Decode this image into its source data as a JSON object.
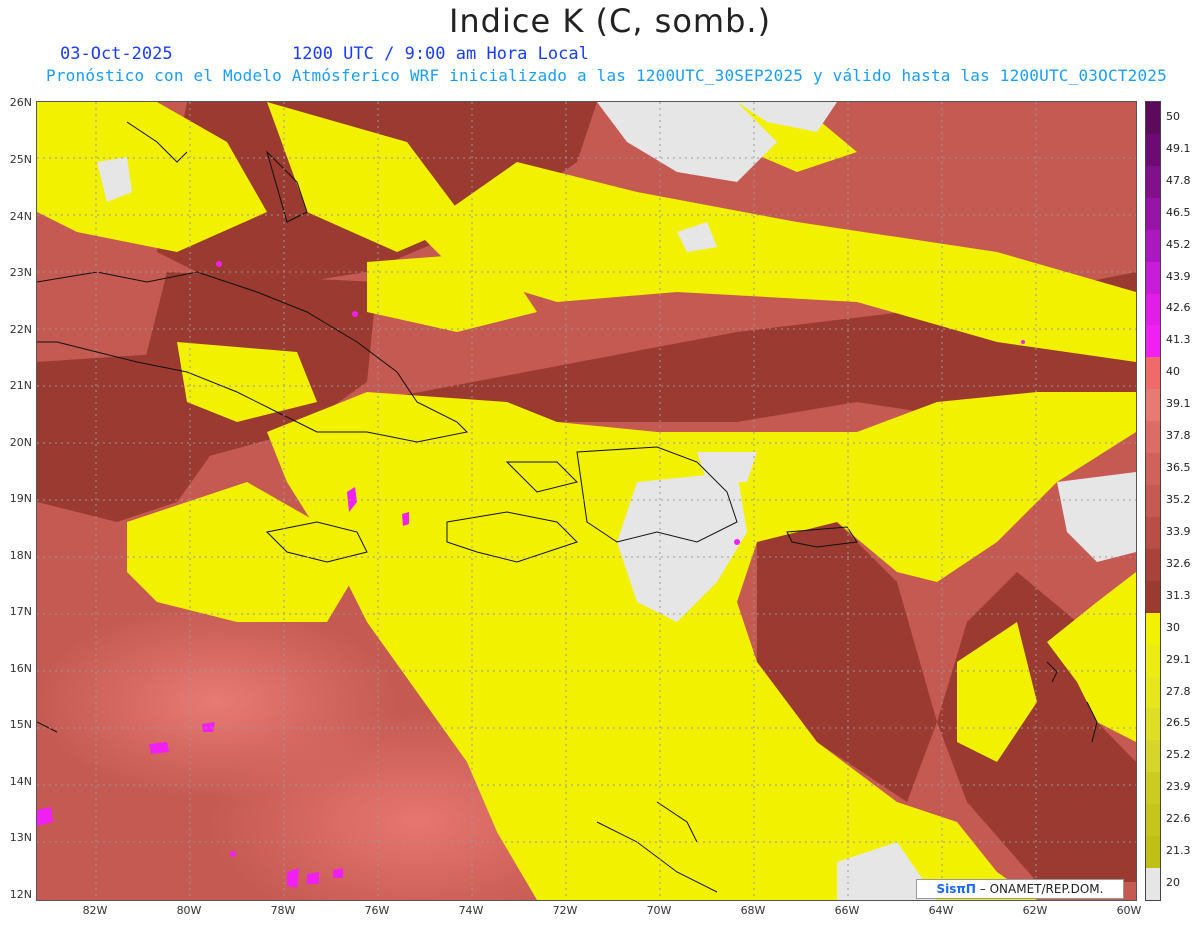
{
  "header": {
    "title": "Indice K (C, somb.)",
    "date": "03-Oct-2025",
    "utc_line": "1200 UTC / 9:00 am Hora Local",
    "subtitle": "Pronóstico con el Modelo Atmósferico WRF inicializado a las 1200UTC_30SEP2025 y válido hasta las  1200UTC_03OCT2025"
  },
  "axes": {
    "y_labels": [
      "26N",
      "25N",
      "24N",
      "23N",
      "22N",
      "21N",
      "20N",
      "19N",
      "18N",
      "17N",
      "16N",
      "15N",
      "14N",
      "13N",
      "12N"
    ],
    "x_labels": [
      "82W",
      "80W",
      "78W",
      "76W",
      "74W",
      "72W",
      "70W",
      "68W",
      "66W",
      "64W",
      "62W",
      "60W"
    ]
  },
  "colorbar": {
    "labels": [
      "50",
      "49.1",
      "47.8",
      "46.5",
      "45.2",
      "43.9",
      "42.6",
      "41.3",
      "40",
      "39.1",
      "37.8",
      "36.5",
      "35.2",
      "33.9",
      "32.6",
      "31.3",
      "30",
      "29.1",
      "27.8",
      "26.5",
      "25.2",
      "23.9",
      "22.6",
      "21.3",
      "20"
    ],
    "colors": [
      "#5c0a5c",
      "#6e0a74",
      "#80108c",
      "#9614a6",
      "#ac18c0",
      "#c81cd8",
      "#e01ee8",
      "#f020f4",
      "#f06a6a",
      "#e87a74",
      "#dc6c66",
      "#d0625c",
      "#c45a52",
      "#b84e46",
      "#a9423a",
      "#9a3a30",
      "#f2f200",
      "#ecec14",
      "#e6e61c",
      "#dede24",
      "#d6d62a",
      "#cccc20",
      "#c6c61a",
      "#c0c014",
      "#e6e6e6"
    ]
  },
  "credit": {
    "brand": "SisπΠ",
    "text": "– ONAMET/REP.DOM."
  },
  "colors": {
    "low_k_yellow": "#f2f200",
    "mid_red": "#c45a52",
    "dark_red": "#9a3a30",
    "no_data": "#e6e6e6",
    "high_k_magenta": "#f020f4"
  }
}
